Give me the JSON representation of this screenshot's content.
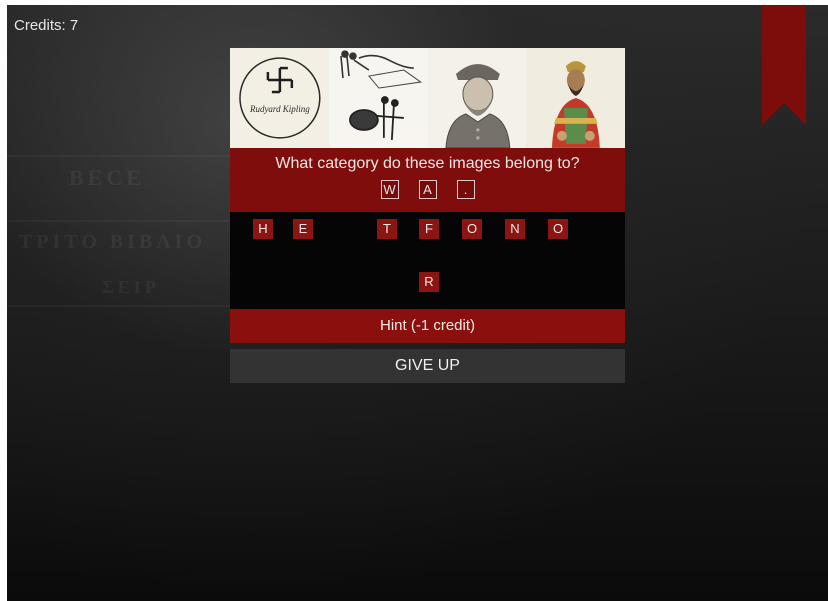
{
  "hud": {
    "credits_text": "Credits: 7"
  },
  "puzzle": {
    "images": [
      {
        "name": "emblem-image",
        "caption": "Rudyard Kipling"
      },
      {
        "name": "sketch-image"
      },
      {
        "name": "general-portrait-image"
      },
      {
        "name": "emperor-portrait-image"
      }
    ],
    "question": "What category do these images belong to?",
    "answer_slots": [
      "W",
      "A",
      "."
    ],
    "letter_tiles_row1": [
      "H",
      "E",
      "T",
      "F",
      "O",
      "N",
      "O"
    ],
    "letter_tiles_row2": [
      "R"
    ]
  },
  "actions": {
    "hint_label": "Hint (-1 credit)",
    "give_up_label": "GIVE UP"
  },
  "theme": {
    "accent": "#7f0d0b",
    "tile": "#8b1512",
    "panel_dark": "#050505",
    "button_gray": "#333333"
  }
}
